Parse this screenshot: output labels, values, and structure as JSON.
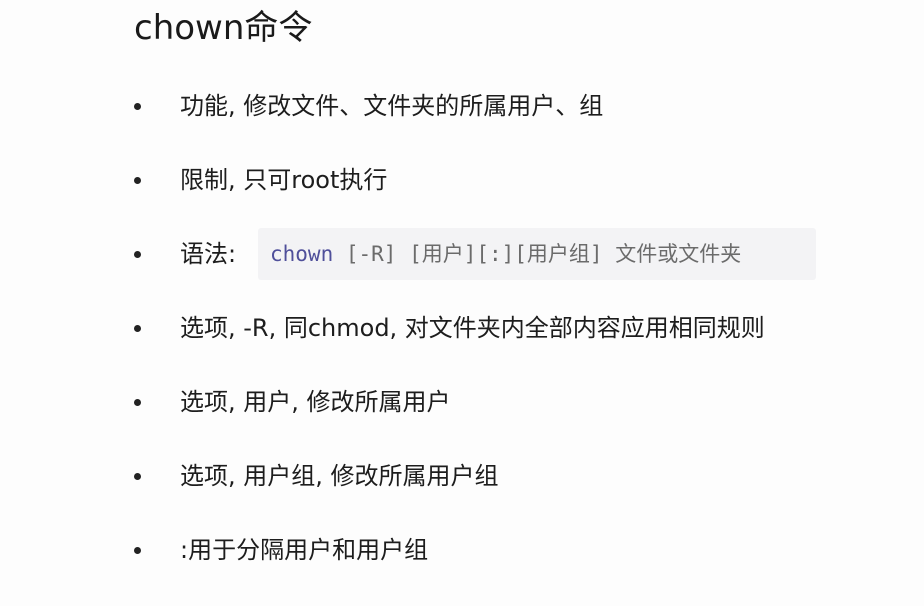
{
  "title": "chown命令",
  "items": [
    {
      "text": "功能, 修改文件、文件夹的所属用户、组"
    },
    {
      "text": "限制, 只可root执行"
    },
    {
      "label": "语法:",
      "code": {
        "command": "chown",
        "args": " [-R] [用户][:][用户组] 文件或文件夹"
      }
    },
    {
      "text": "选项, -R, 同chmod, 对文件夹内全部内容应用相同规则"
    },
    {
      "text": "选项, 用户, 修改所属用户"
    },
    {
      "text": "选项, 用户组, 修改所属用户组"
    },
    {
      "text": ":用于分隔用户和用户组"
    }
  ],
  "colors": {
    "code_command": "#4f4f9a",
    "code_background": "#f3f3f5"
  }
}
